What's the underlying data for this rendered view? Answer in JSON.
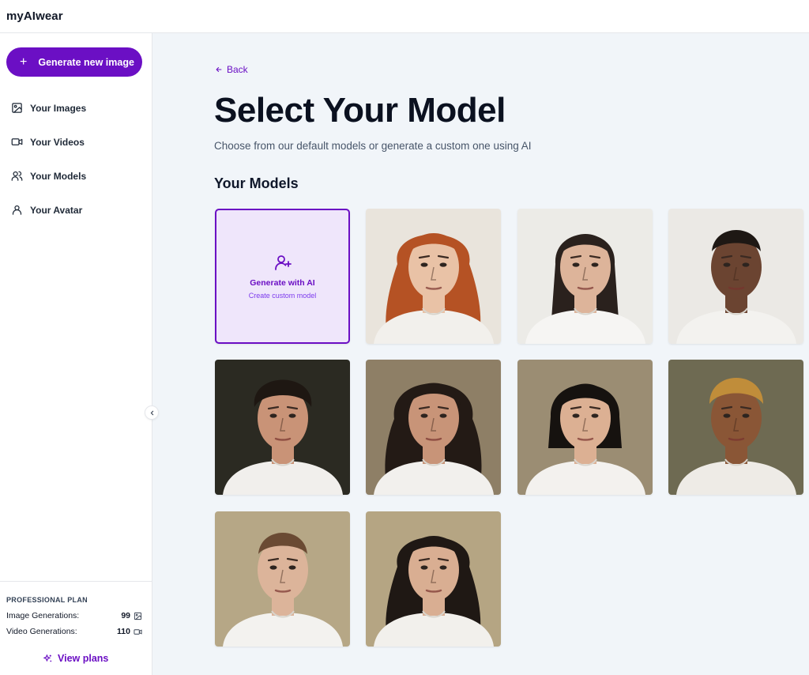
{
  "app": {
    "title": "myAIwear"
  },
  "sidebar": {
    "generate_label": "Generate new image",
    "items": [
      {
        "label": "Your Images",
        "icon": "image-icon"
      },
      {
        "label": "Your Videos",
        "icon": "video-icon"
      },
      {
        "label": "Your Models",
        "icon": "users-icon"
      },
      {
        "label": "Your Avatar",
        "icon": "user-icon"
      }
    ],
    "plan": {
      "title": "PROFESSIONAL PLAN",
      "image_label": "Image Generations:",
      "image_count": "99",
      "video_label": "Video Generations:",
      "video_count": "110",
      "view_plans": "View plans"
    }
  },
  "main": {
    "back_label": "Back",
    "title": "Select Your Model",
    "subtitle": "Choose from our default models or generate a custom one using AI",
    "section_title": "Your Models",
    "generate_tile": {
      "label": "Generate with AI",
      "sublabel": "Create custom model"
    },
    "models": [
      {
        "name": "model-1",
        "bg": "#e9e4dc",
        "skin": "#e9c2a6",
        "hair": "#b55224",
        "hair_style": "long-wavy",
        "shirt": "#f2f0ec"
      },
      {
        "name": "model-2",
        "bg": "#ecebe7",
        "skin": "#ddb49a",
        "hair": "#2a211d",
        "hair_style": "long-straight",
        "shirt": "#f6f5f3"
      },
      {
        "name": "model-3",
        "bg": "#ebe9e5",
        "skin": "#6b4431",
        "hair": "#1e1814",
        "hair_style": "pulled-back",
        "shirt": "#f3f2ef"
      },
      {
        "name": "model-4",
        "bg": "#2b2a22",
        "skin": "#c99377",
        "hair": "#1e1712",
        "hair_style": "short-curly",
        "shirt": "#f1efec"
      },
      {
        "name": "model-5",
        "bg": "#8e7f66",
        "skin": "#c89478",
        "hair": "#231a15",
        "hair_style": "long-curly",
        "shirt": "#f2f0ed"
      },
      {
        "name": "model-6",
        "bg": "#9b8d73",
        "skin": "#dcb093",
        "hair": "#16120f",
        "hair_style": "bob",
        "shirt": "#f3f1ee"
      },
      {
        "name": "model-7",
        "bg": "#6e6a52",
        "skin": "#8a5636",
        "hair": "#c08d3a",
        "hair_style": "buzz",
        "shirt": "#eeebe6"
      },
      {
        "name": "model-8",
        "bg": "#b6a786",
        "skin": "#dcb49a",
        "hair": "#6a4a33",
        "hair_style": "pulled-back",
        "shirt": "#f3f2ef"
      },
      {
        "name": "model-9",
        "bg": "#b5a583",
        "skin": "#d9ae92",
        "hair": "#1f1814",
        "hair_style": "long-wavy",
        "shirt": "#f2f0ec"
      }
    ]
  },
  "colors": {
    "accent": "#6b0fc4",
    "main_bg": "#f1f5f9",
    "generate_tile_bg": "#efe6fb"
  }
}
